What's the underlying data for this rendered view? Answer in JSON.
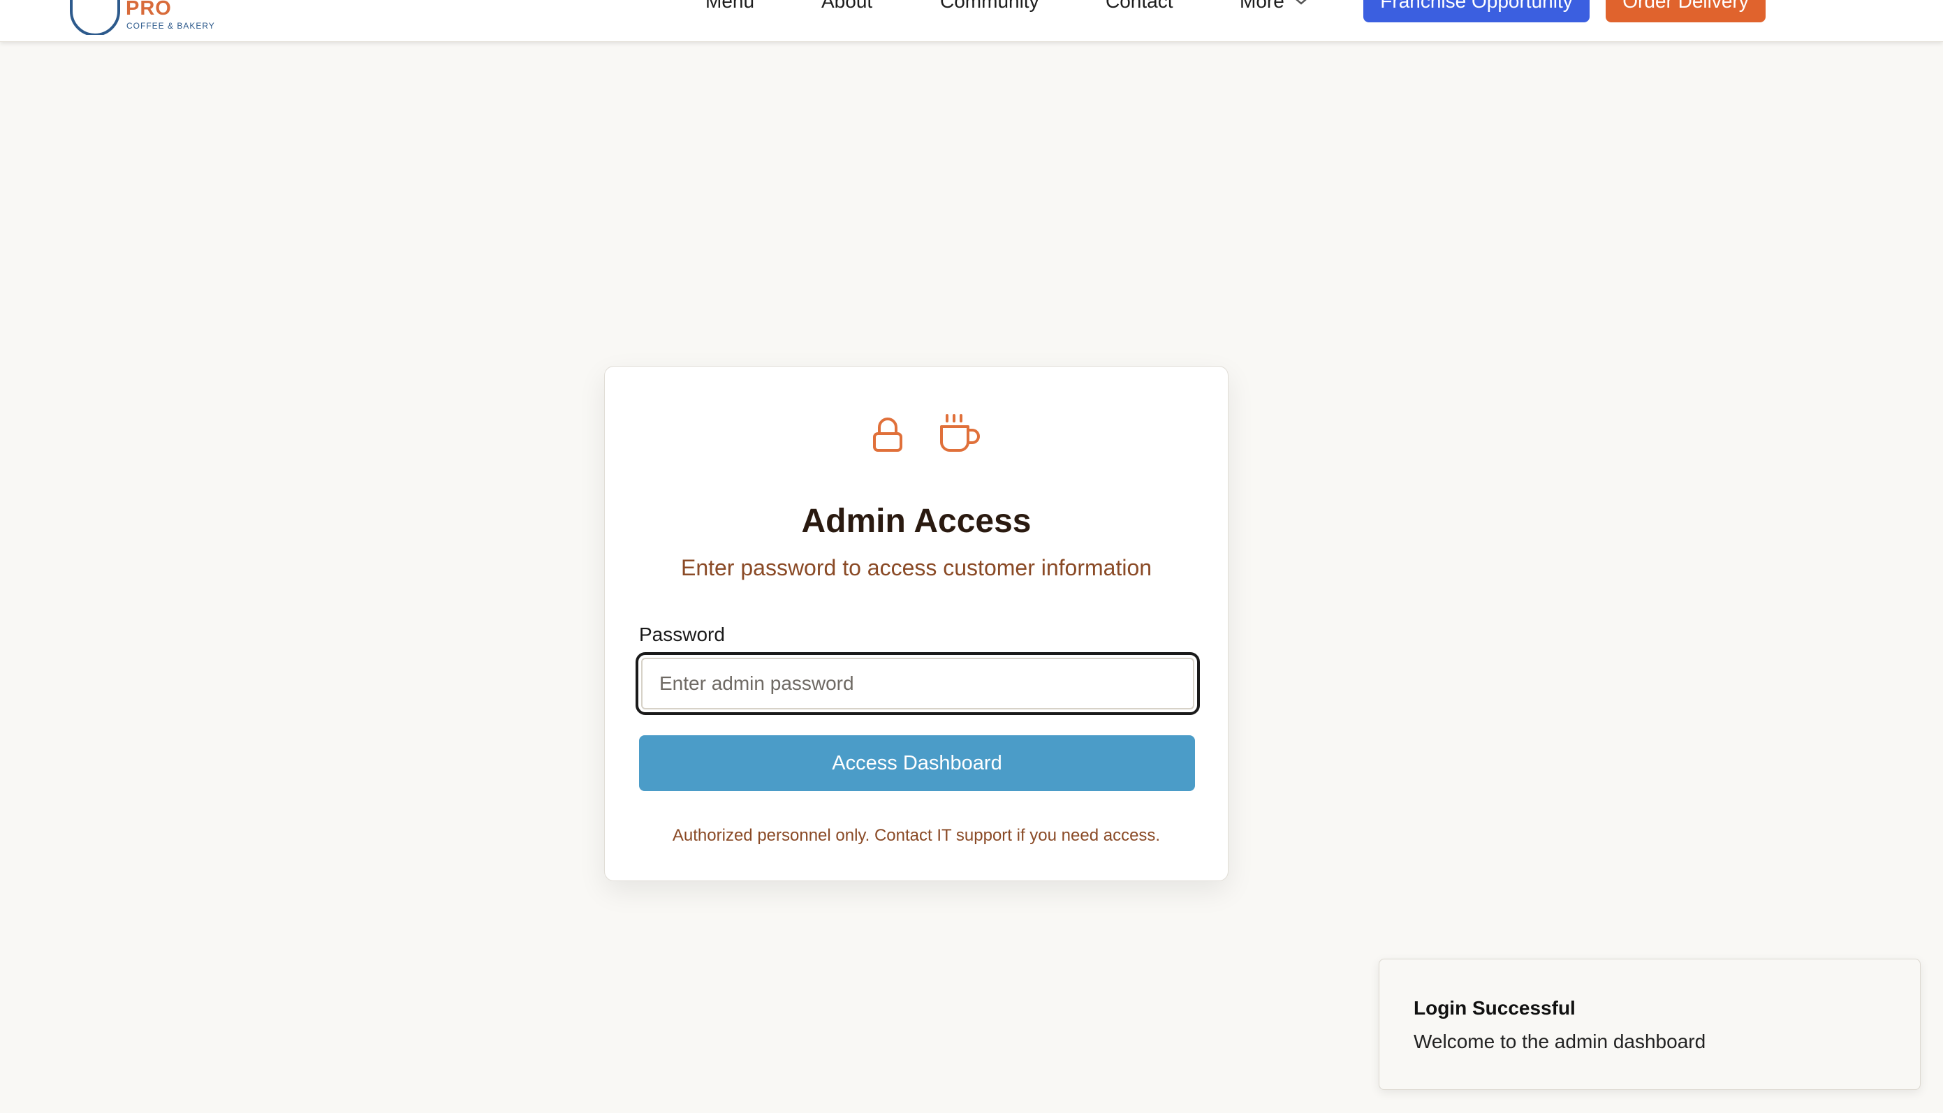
{
  "header": {
    "logo": {
      "brand": "PRO",
      "tagline": "COFFEE & BAKERY"
    },
    "nav": [
      "Menu",
      "About",
      "Community",
      "Contact",
      "More"
    ],
    "buttons": {
      "franchise": "Franchise Opportunity",
      "order": "Order Delivery"
    }
  },
  "card": {
    "icons": [
      "lock-icon",
      "coffee-cup-icon"
    ],
    "title": "Admin Access",
    "subtitle": "Enter password to access customer information",
    "password_label": "Password",
    "password_placeholder": "Enter admin password",
    "password_value": "",
    "submit_label": "Access Dashboard",
    "note": "Authorized personnel only. Contact IT support if you need access."
  },
  "toast": {
    "title": "Login Successful",
    "message": "Welcome to the admin dashboard"
  },
  "colors": {
    "accent_orange": "#e0632d",
    "primary_blue": "#3b5fe0",
    "submit_blue": "#4b9cc8",
    "brown_text": "#8a4a26",
    "background": "#f9f8f5"
  }
}
